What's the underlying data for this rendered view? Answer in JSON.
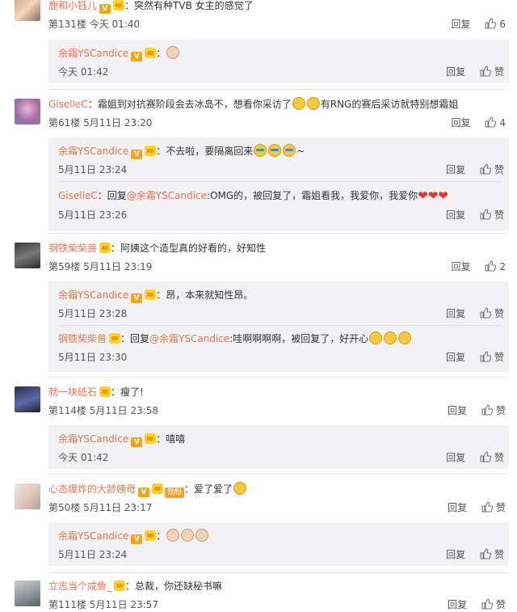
{
  "labels": {
    "reply": "回复",
    "like": "赞",
    "colon": "：",
    "reply_to": "回复"
  },
  "colors": {
    "username": "#eb7350",
    "reply_bg": "#f2f2f5",
    "heart": "#e3322f",
    "vip_gold": "#fdd22a"
  },
  "comments": [
    {
      "user": "鹿和小钰儿",
      "verified": true,
      "text": "突然有种TVB 女主的感觉了",
      "floor": "第131楼",
      "time": "今天 01:40",
      "likes": "6",
      "replies": [
        {
          "user": "余霜YSCandice",
          "verified": true,
          "text": "",
          "emoji": [
            "dog"
          ],
          "time": "今天 01:42",
          "likes": "赞"
        }
      ]
    },
    {
      "user": "GiselleC",
      "verified": false,
      "text": "霜姐到对抗赛阶段会去冰岛不，想看你采访了",
      "text_tail": "有RNG的赛后采访就特别想霜姐",
      "emoji": [
        "laugh",
        "laugh"
      ],
      "floor": "第61楼",
      "time": "5月11日 23:20",
      "likes": "4",
      "replies": [
        {
          "user": "余霜YSCandice",
          "verified": true,
          "text": "不去啦，要隔离回来",
          "emoji": [
            "sunglass",
            "sunglass",
            "sunglass"
          ],
          "text_tail": "~",
          "time": "5月11日 23:24",
          "likes": "赞"
        },
        {
          "user": "GiselleC",
          "verified": false,
          "reply_to": "@余霜YSCandice",
          "text": ":OMG的，被回复了，霜姐看我，我爱你，我爱你",
          "emoji": [
            "heart",
            "heart",
            "heart"
          ],
          "time": "5月11日 23:26",
          "likes": "赞"
        }
      ]
    },
    {
      "user": "钢铁柴柴兽",
      "verified": false,
      "text": "阿姨这个造型真的好看的，好知性",
      "floor": "第59楼",
      "time": "5月11日 23:19",
      "likes": "2",
      "replies": [
        {
          "user": "余霜YSCandice",
          "verified": true,
          "text": "昂，本来就知性昂。",
          "time": "5月11日 23:28",
          "likes": "赞"
        },
        {
          "user": "钢铁柴柴兽",
          "verified": false,
          "reply_to": "@余霜YSCandice",
          "text": ":哇啊啊啊啊，被回复了，好开心",
          "emoji": [
            "love",
            "love",
            "love"
          ],
          "time": "5月11日 23:30",
          "likes": "赞"
        }
      ]
    },
    {
      "user": "就一块砥石",
      "verified": false,
      "text": "瘦了!",
      "floor": "第114楼",
      "time": "5月11日 23:58",
      "likes": "赞",
      "replies": [
        {
          "user": "余霜YSCandice",
          "verified": true,
          "text": "嘻嘻",
          "time": "今天 01:42",
          "likes": "赞"
        }
      ]
    },
    {
      "user": "心态爆炸的大龄姨母",
      "verified": true,
      "fan_badge": "铁粉",
      "text": "爱了爱了",
      "emoji": [
        "shock"
      ],
      "floor": "第50楼",
      "time": "5月11日 23:17",
      "likes": "赞",
      "replies": [
        {
          "user": "余霜YSCandice",
          "verified": true,
          "text": "",
          "emoji": [
            "dog",
            "dog",
            "dog"
          ],
          "time": "5月11日 23:24",
          "likes": "赞"
        }
      ]
    },
    {
      "user": "立志当个咸鱼_",
      "verified": false,
      "text": "总裁，你还缺秘书嘛",
      "floor": "第111楼",
      "time": "5月11日 23:57",
      "likes": "赞",
      "replies": []
    }
  ]
}
